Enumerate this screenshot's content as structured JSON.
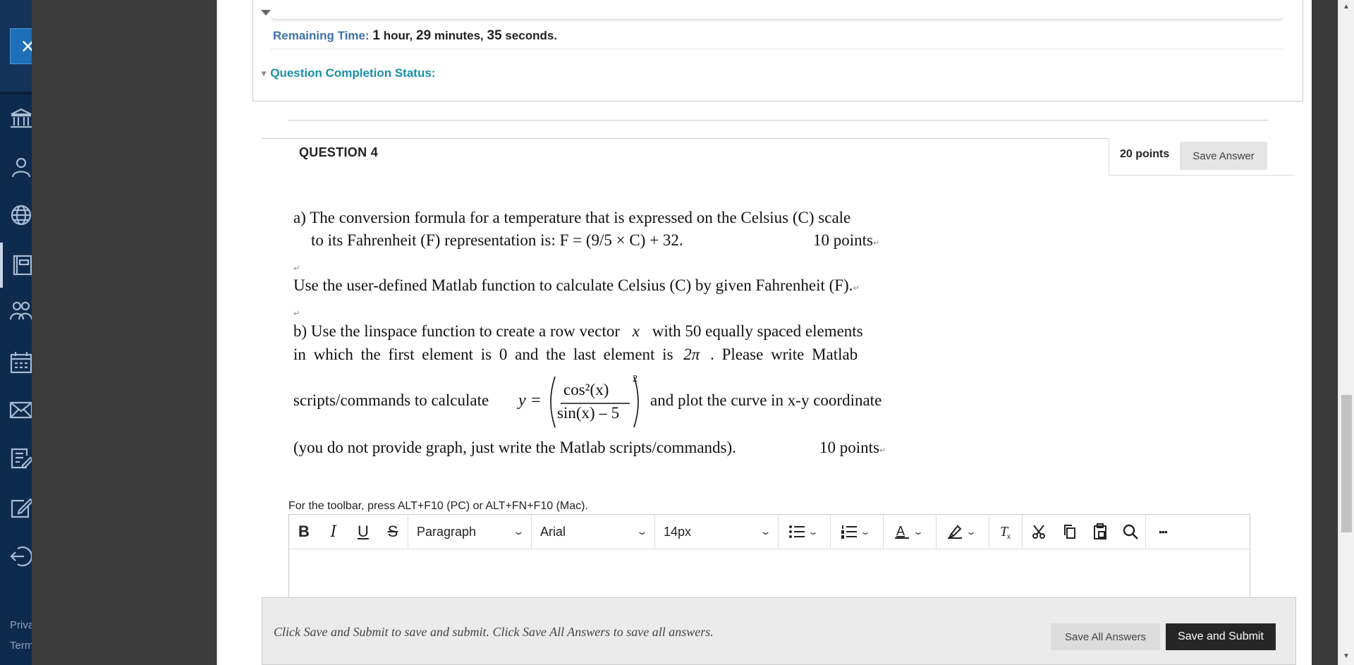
{
  "close_label": "×",
  "nav": {
    "icons": [
      "institution-icon",
      "user-icon",
      "globe-icon",
      "courses-icon",
      "groups-icon",
      "calendar-icon",
      "mail-icon",
      "grades-icon",
      "assignment-icon",
      "logout-icon"
    ],
    "footer": [
      "Priva",
      "Term"
    ]
  },
  "status": {
    "remaining_label": "Remaining Time:",
    "hours": "1",
    "hours_unit": "hour,",
    "minutes": "29",
    "minutes_unit": "minutes,",
    "seconds": "35",
    "seconds_unit": "seconds.",
    "completion_label": "Question Completion Status:"
  },
  "question": {
    "title": "QUESTION 4",
    "points": "20 points",
    "save_answer": "Save Answer",
    "line_a1": "a) The conversion formula for a temperature that is expressed on the Celsius (C) scale",
    "line_a2": "to its Fahrenheit (F) representation is: F = (9/5 × C) + 32.",
    "line_a2_points": "10 points",
    "line_use": "Use the user-defined Matlab function to calculate Celsius (C) by given Fahrenheit (F).",
    "line_b1_start": "b) Use the linspace function to create a row vector",
    "var_x": "x",
    "line_b1_end": "with 50 equally spaced elements",
    "line_b2": "in which the first element is 0 and the last element is",
    "two_pi": "2π",
    "line_b2_end": ". Please write Matlab",
    "line_b3_start": "scripts/commands to calculate",
    "formula_y": "y =",
    "formula_num": "cos²(x)",
    "formula_den": "sin(x) – 5",
    "formula_exp": "2",
    "line_b3_end": "and plot the curve in x-y coordinate",
    "line_b4": "(you do not provide graph, just write the Matlab scripts/commands).",
    "line_b4_points": "10 points",
    "para_mark": "↵"
  },
  "editor": {
    "toolbar_hint": "For the toolbar, press ALT+F10 (PC) or ALT+FN+F10 (Mac).",
    "bold": "B",
    "italic": "I",
    "underline": "U",
    "strike": "S",
    "block_format": "Paragraph",
    "font_family": "Arial",
    "font_size": "14px",
    "more": "•••"
  },
  "footer_bar": {
    "hint": "Click Save and Submit to save and submit. Click Save All Answers to save all answers.",
    "save_all": "Save All Answers",
    "save_submit": "Save and Submit"
  }
}
